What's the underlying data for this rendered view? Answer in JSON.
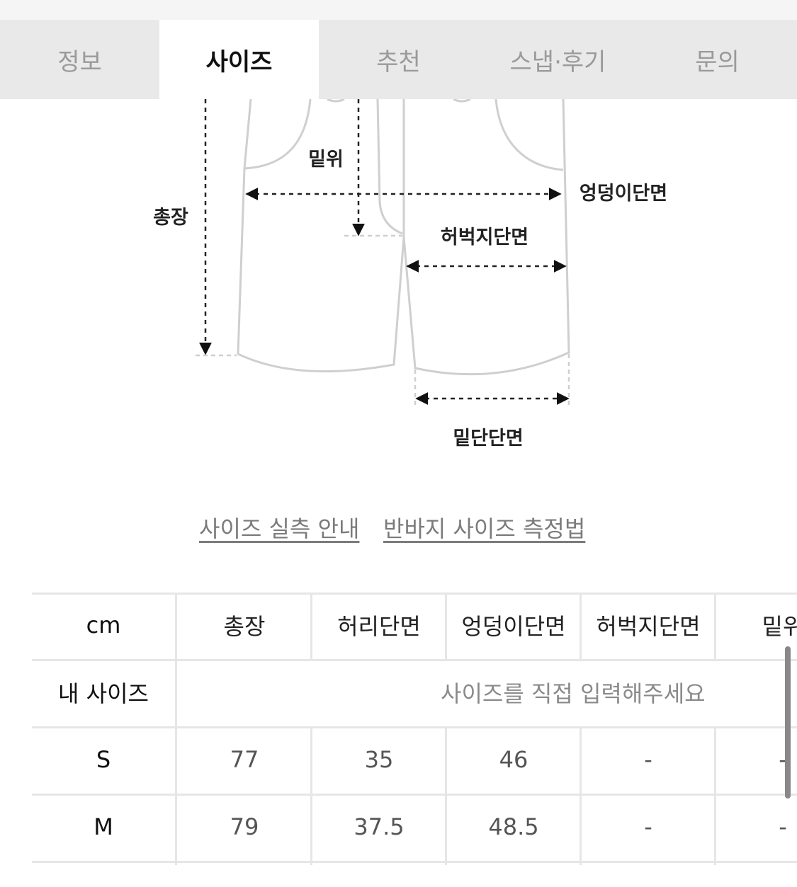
{
  "tabs": [
    {
      "label": "정보"
    },
    {
      "label": "사이즈"
    },
    {
      "label": "추천"
    },
    {
      "label": "스냅·후기"
    },
    {
      "label": "문의"
    }
  ],
  "diagram": {
    "labels": {
      "rise": "밑위",
      "total_length": "총장",
      "hip": "엉덩이단면",
      "thigh": "허벅지단면",
      "hem": "밑단단면"
    }
  },
  "links": {
    "size_guide": "사이즈 실측 안내",
    "measure_method": "반바지 사이즈 측정법"
  },
  "size_table": {
    "unit": "cm",
    "columns": [
      "총장",
      "허리단면",
      "엉덩이단면",
      "허벅지단면",
      "밑위"
    ],
    "my_size_label": "내 사이즈",
    "my_size_placeholder": "사이즈를 직접 입력해주세요",
    "rows": [
      {
        "size": "S",
        "values": [
          "77",
          "35",
          "46",
          "-",
          "-"
        ]
      },
      {
        "size": "M",
        "values": [
          "79",
          "37.5",
          "48.5",
          "-",
          "-"
        ]
      }
    ]
  }
}
